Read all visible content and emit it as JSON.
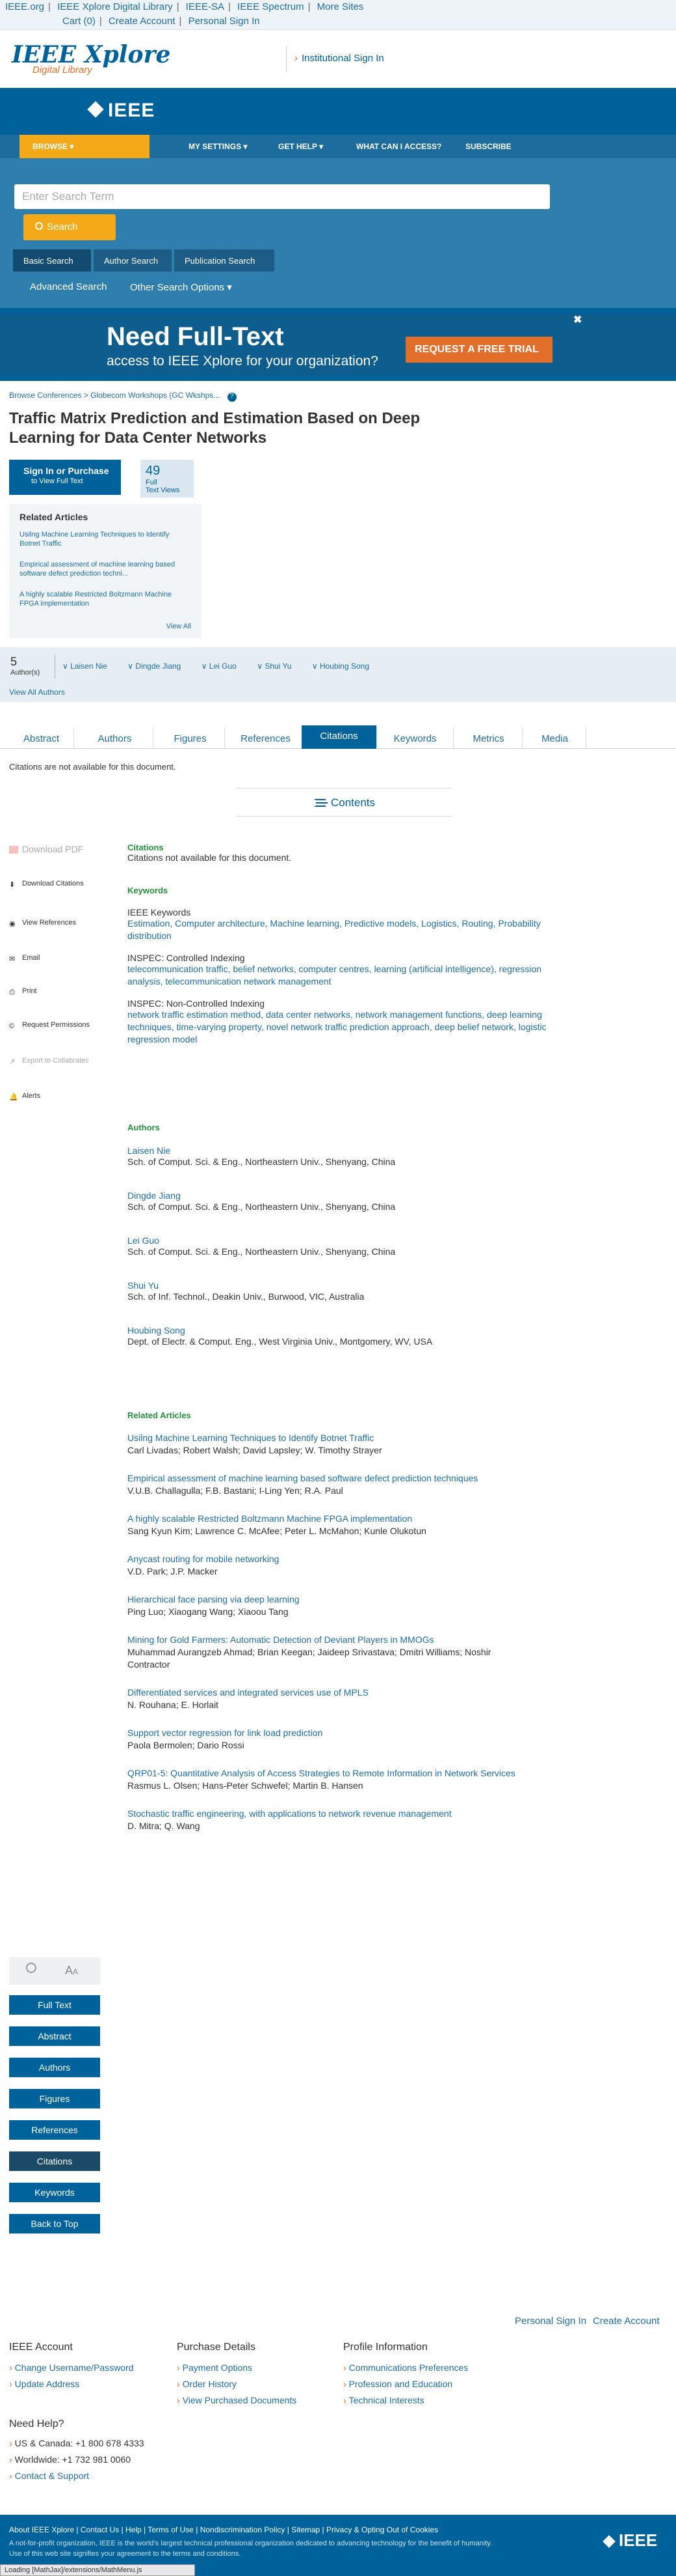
{
  "topstrip": {
    "row1": [
      "IEEE.org",
      "IEEE Xplore Digital Library",
      "IEEE-SA",
      "IEEE Spectrum",
      "More Sites"
    ],
    "row2": [
      "Cart (0)",
      "Create Account",
      "Personal Sign In"
    ]
  },
  "brand": {
    "logo": "IEEE Xplore",
    "logo_sub": "Digital Library",
    "institutional_signin": "Institutional Sign In"
  },
  "ieee_logo": "IEEE",
  "nav": {
    "browse": "BROWSE",
    "items": [
      "MY SETTINGS",
      "GET HELP",
      "WHAT CAN I ACCESS?",
      "SUBSCRIBE"
    ]
  },
  "search": {
    "placeholder": "Enter Search Term",
    "button": "Search",
    "tabs": [
      "Basic Search",
      "Author Search",
      "Publication Search"
    ],
    "advanced": "Advanced Search",
    "other": "Other Search Options"
  },
  "ad": {
    "title": "Need Full-Text",
    "subtitle": "access to IEEE Xplore for your organization?",
    "cta": "REQUEST A FREE TRIAL",
    "close": "✖"
  },
  "breadcrumb": [
    "Browse Conferences",
    "Globecom Workshops (GC Wkshps..."
  ],
  "doc": {
    "title": "Traffic Matrix Prediction and Estimation Based on Deep Learning for Data Center Networks",
    "signin_label": "Sign In or Purchase",
    "signin_sub": "to View Full Text",
    "fulltext_views": "49",
    "fulltext_label1": "Full",
    "fulltext_label2": "Text Views"
  },
  "related_box": {
    "title": "Related Articles",
    "items": [
      "Usilng Machine Learning Techniques to Identify Botnet Traffic",
      "Empirical assessment of machine learning based software defect prediction techni...",
      "A highly scalable Restricted Boltzmann Machine FPGA implementation"
    ],
    "view_all": "View All"
  },
  "authors_bar": {
    "count": "5",
    "count_label": "Author(s)",
    "names": [
      "Laisen Nie",
      "Dingde Jiang",
      "Lei Guo",
      "Shui Yu",
      "Houbing Song"
    ],
    "view_all": "View All Authors"
  },
  "tabs": [
    "Abstract",
    "Authors",
    "Figures",
    "References",
    "Citations",
    "Keywords",
    "Metrics",
    "Media"
  ],
  "no_citations": "Citations are not available for this document.",
  "contents": "Contents",
  "tools": [
    "Download PDF",
    "Download Citations",
    "View References",
    "Email",
    "Print",
    "Request Permissions",
    "Export to Collabratec",
    "Alerts"
  ],
  "citations": {
    "head": "Citations",
    "text": "Citations not available for this document."
  },
  "keywords": {
    "head": "Keywords",
    "groups": [
      {
        "name": "IEEE Keywords",
        "text": "Estimation, Computer architecture, Machine learning, Predictive models, Logistics, Routing, Probability distribution"
      },
      {
        "name": "INSPEC: Controlled Indexing",
        "text": "telecommunication traffic, belief networks, computer centres, learning (artificial intelligence), regression analysis, telecommunication network management"
      },
      {
        "name": "INSPEC: Non-Controlled Indexing",
        "text": "network traffic estimation method, data center networks, network management functions, deep learning techniques, time-varying property, novel network traffic prediction approach, deep belief network, logistic regression model"
      }
    ]
  },
  "authors": {
    "head": "Authors",
    "list": [
      {
        "name": "Laisen Nie",
        "aff": "Sch. of Comput. Sci. & Eng., Northeastern Univ., Shenyang, China"
      },
      {
        "name": "Dingde Jiang",
        "aff": "Sch. of Comput. Sci. & Eng., Northeastern Univ., Shenyang, China"
      },
      {
        "name": "Lei Guo",
        "aff": "Sch. of Comput. Sci. & Eng., Northeastern Univ., Shenyang, China"
      },
      {
        "name": "Shui Yu",
        "aff": "Sch. of Inf. Technol., Deakin Univ., Burwood, VIC, Australia"
      },
      {
        "name": "Houbing Song",
        "aff": "Dept. of Electr. & Comput. Eng., West Virginia Univ., Montgomery, WV, USA"
      }
    ]
  },
  "related": {
    "head": "Related Articles",
    "list": [
      {
        "title": "Usilng Machine Learning Techniques to Identify Botnet Traffic",
        "authors": "Carl Livadas; Robert Walsh; David Lapsley; W. Timothy Strayer"
      },
      {
        "title": "Empirical assessment of machine learning based software defect prediction techniques",
        "authors": "V.U.B. Challagulla; F.B. Bastani; I-Ling Yen; R.A. Paul"
      },
      {
        "title": "A highly scalable Restricted Boltzmann Machine FPGA implementation",
        "authors": "Sang Kyun Kim; Lawrence C. McAfee; Peter L. McMahon; Kunle Olukotun"
      },
      {
        "title": "Anycast routing for mobile networking",
        "authors": "V.D. Park; J.P. Macker"
      },
      {
        "title": "Hierarchical face parsing via deep learning",
        "authors": "Ping Luo; Xiaogang Wang; Xiaoou Tang"
      },
      {
        "title": "Mining for Gold Farmers: Automatic Detection of Deviant Players in MMOGs",
        "authors": "Muhammad Aurangzeb Ahmad; Brian Keegan; Jaideep Srivastava; Dmitri Williams; Noshir Contractor"
      },
      {
        "title": "Differentiated services and integrated services use of MPLS",
        "authors": "N. Rouhana; E. Horlait"
      },
      {
        "title": "Support vector regression for link load prediction",
        "authors": "Paola Bermolen; Dario Rossi"
      },
      {
        "title": "QRP01-5: Quantitative Analysis of Access Strategies to Remote Information in Network Services",
        "authors": "Rasmus L. Olsen; Hans-Peter Schwefel; Martin B. Hansen"
      },
      {
        "title": "Stochastic traffic engineering, with applications to network revenue management",
        "authors": "D. Mitra; Q. Wang"
      }
    ]
  },
  "leftnav": {
    "buttons": [
      "Full Text",
      "Abstract",
      "Authors",
      "Figures",
      "References",
      "Citations",
      "Keywords",
      "Back to Top"
    ]
  },
  "footer": {
    "personal_signin": "Personal Sign In",
    "create_account": "Create Account",
    "cols": [
      {
        "head": "IEEE Account",
        "items": [
          "Change Username/Password",
          "Update Address"
        ]
      },
      {
        "head": "Purchase Details",
        "items": [
          "Payment Options",
          "Order History",
          "View Purchased Documents"
        ]
      },
      {
        "head": "Profile Information",
        "items": [
          "Communications Preferences",
          "Profession and Education",
          "Technical Interests"
        ]
      }
    ],
    "help_head": "Need Help?",
    "help_items": [
      "US & Canada: +1 800 678 4333",
      "Worldwide: +1 732 981 0060",
      "Contact & Support"
    ],
    "nav": "About IEEE Xplore | Contact Us | Help | Terms of Use | Nondiscrimination Policy | Sitemap | Privacy & Opting Out of Cookies",
    "note1": "A not-for-profit organization, IEEE is the world's largest technical professional organization dedicated to advancing technology for the benefit of humanity.",
    "note2": "Use of this web site signifies your agreement to the terms and conditions.",
    "logo": "IEEE",
    "loading": "Loading [MathJax]/extensions/MathMenu.js"
  }
}
